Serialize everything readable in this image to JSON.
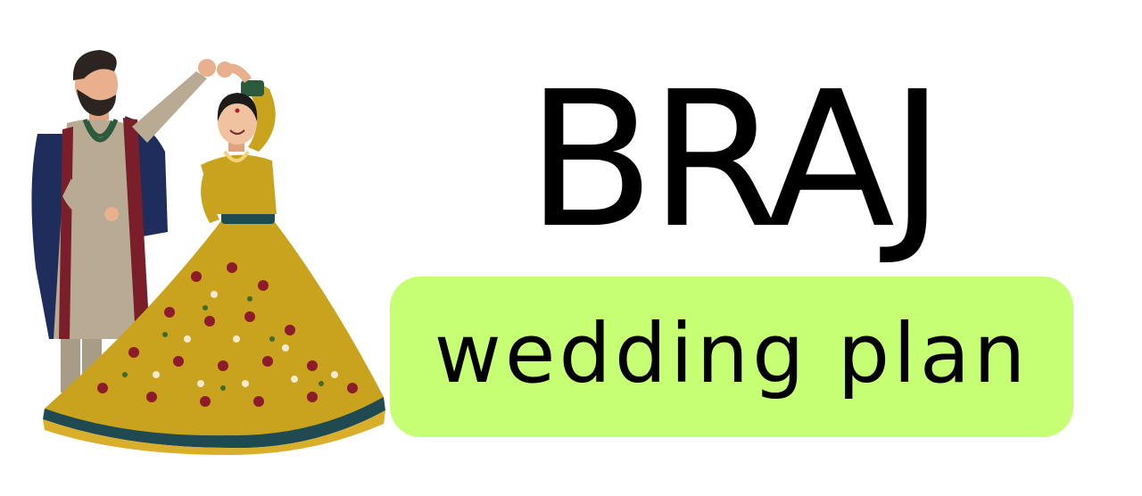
{
  "brand": {
    "title": "BRAJ",
    "tagline": "wedding plan"
  },
  "colors": {
    "background": "#ffffff",
    "text": "#000000",
    "tagline_background": "#c6ff74",
    "lehenga_mustard": "#c9a21e",
    "sherwani_navy": "#1f2d5c",
    "kurta_beige": "#b9ab93"
  },
  "illustration": {
    "icon": "dancing-couple-icon"
  }
}
